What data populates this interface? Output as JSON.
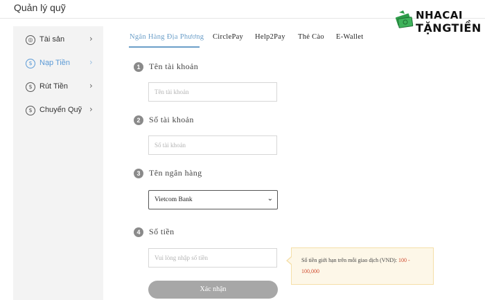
{
  "page": {
    "title": "Quản lý quỹ"
  },
  "logo": {
    "line1": "NHACAI",
    "line2": "TẶNGTIỀN"
  },
  "sidebar": {
    "items": [
      {
        "label": "Tài sản",
        "icon": "asset-icon",
        "icon_glyph": "◎",
        "chevron": "›",
        "active": false
      },
      {
        "label": "Nạp Tiền",
        "icon": "deposit-icon",
        "icon_glyph": "$",
        "chevron": "›",
        "active": true
      },
      {
        "label": "Rút Tiền",
        "icon": "withdraw-icon",
        "icon_glyph": "$",
        "chevron": "›",
        "active": false
      },
      {
        "label": "Chuyển Quỹ",
        "icon": "transfer-icon",
        "icon_glyph": "$",
        "chevron": "›",
        "active": false
      }
    ]
  },
  "tabs": [
    {
      "label": "Ngân Hàng Địa Phương",
      "active": true
    },
    {
      "label": "CirclePay",
      "active": false
    },
    {
      "label": "Help2Pay",
      "active": false
    },
    {
      "label": "Thẻ Cào",
      "active": false
    },
    {
      "label": "E-Wallet",
      "active": false
    }
  ],
  "form": {
    "account_name": {
      "step": "1",
      "label": "Tên tài khoản",
      "value": "",
      "placeholder": "Tên tài khoản"
    },
    "account_number": {
      "step": "2",
      "label": "Số tài khoản",
      "value": "",
      "placeholder": "Số tài khoản"
    },
    "bank_name": {
      "step": "3",
      "label": "Tên ngân hàng",
      "selected": "Vietcom Bank"
    },
    "amount": {
      "step": "4",
      "label": "Số tiền",
      "value": "",
      "placeholder": "Vui lòng nhập số tiền"
    },
    "limit_notice": {
      "text": "Số tiền giới hạn trên mỗi giao dịch (VND):",
      "range": "100 - 100,000"
    },
    "submit_label": "Xác nhận"
  },
  "colors": {
    "accent": "#6a9ec8",
    "active_sidebar": "#5b9ad6",
    "notice_bg": "#fdf7e8",
    "notice_range": "#d04a2f",
    "button": "#a7a7a7"
  }
}
